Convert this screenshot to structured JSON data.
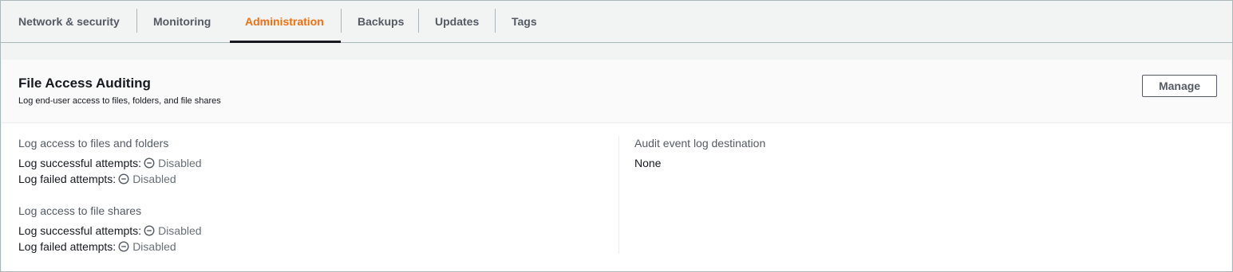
{
  "tabs": [
    {
      "label": "Network & security",
      "active": false
    },
    {
      "label": "Monitoring",
      "active": false
    },
    {
      "label": "Administration",
      "active": true
    },
    {
      "label": "Backups",
      "active": false
    },
    {
      "label": "Updates",
      "active": false
    },
    {
      "label": "Tags",
      "active": false
    }
  ],
  "panel": {
    "title": "File Access Auditing",
    "description": "Log end-user access to files, folders, and file shares",
    "manage_label": "Manage"
  },
  "files_folders": {
    "heading": "Log access to files and folders",
    "successful_label": "Log successful attempts:",
    "successful_status": "Disabled",
    "failed_label": "Log failed attempts:",
    "failed_status": "Disabled"
  },
  "file_shares": {
    "heading": "Log access to file shares",
    "successful_label": "Log successful attempts:",
    "successful_status": "Disabled",
    "failed_label": "Log failed attempts:",
    "failed_status": "Disabled"
  },
  "destination": {
    "heading": "Audit event log destination",
    "value": "None"
  },
  "icons": {
    "status_icon": "minus-circle-icon"
  },
  "colors": {
    "active_tab": "#ec7211",
    "status_disabled": "#687078"
  }
}
